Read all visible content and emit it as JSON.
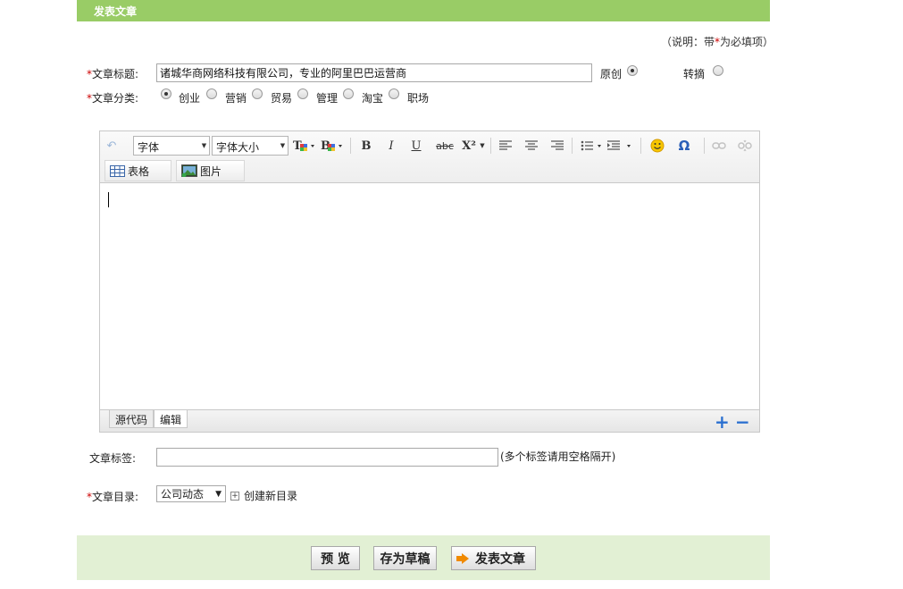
{
  "header": {
    "title": "发表文章"
  },
  "note": {
    "prefix": "（说明：带",
    "star": "*",
    "suffix": "为必填项）"
  },
  "title_field": {
    "star": "*",
    "label": "文章标题:",
    "value": "诸城华商网络科技有限公司，专业的阿里巴巴运营商"
  },
  "source_options": [
    {
      "label": "原创",
      "checked": true
    },
    {
      "label": "转摘",
      "checked": false
    }
  ],
  "category": {
    "star": "*",
    "label": "文章分类:",
    "options": [
      {
        "label": "创业",
        "checked": true
      },
      {
        "label": "营销",
        "checked": false
      },
      {
        "label": "贸易",
        "checked": false
      },
      {
        "label": "管理",
        "checked": false
      },
      {
        "label": "淘宝",
        "checked": false
      },
      {
        "label": "职场",
        "checked": false
      }
    ]
  },
  "editor": {
    "font_select": "字体",
    "size_select": "字体大小",
    "table_button": "表格",
    "image_button": "图片",
    "bold": "B",
    "italic": "I",
    "underline": "U",
    "strike": "abc",
    "superscript": "X²",
    "special_char": "Ω",
    "tab_source": "源代码",
    "tab_edit": "编辑",
    "plus": "+",
    "minus": "−"
  },
  "tags": {
    "label": "文章标签:",
    "hint": "(多个标签请用空格隔开)",
    "value": ""
  },
  "directory": {
    "star": "*",
    "label": "文章目录:",
    "selected": "公司动态",
    "new_link": "创建新目录"
  },
  "buttons": {
    "preview": "预 览",
    "draft": "存为草稿",
    "publish": "发表文章"
  },
  "colors": {
    "header_green": "#99cc66",
    "footer_green": "#e2f0d4",
    "required_red": "#cc0000",
    "accent_orange": "#f08a00"
  }
}
